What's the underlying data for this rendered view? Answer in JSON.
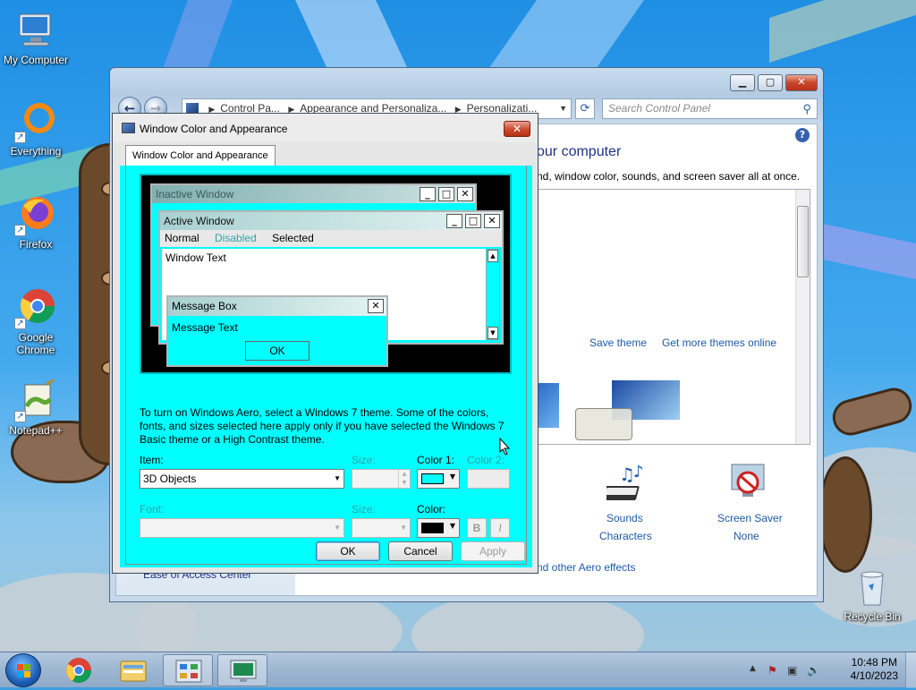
{
  "desktop": {
    "icons": [
      {
        "label": "My Computer",
        "icon": "computer-icon"
      },
      {
        "label": "Everything",
        "icon": "everything-icon"
      },
      {
        "label": "Firefox",
        "icon": "firefox-icon"
      },
      {
        "label": "Google Chrome",
        "icon": "chrome-icon"
      },
      {
        "label": "Notepad++",
        "icon": "notepadpp-icon"
      },
      {
        "label": "Recycle Bin",
        "icon": "recycle-bin-icon"
      }
    ]
  },
  "control_panel": {
    "breadcrumbs": [
      "Control Pa...",
      "Appearance and Personaliza...",
      "Personalizati..."
    ],
    "search_placeholder": "Search Control Panel",
    "heading": "our computer",
    "subtext": "nd, window color, sounds, and screen saver all at once.",
    "save_theme": "Save theme",
    "get_more_themes": "Get more themes online",
    "sounds_label": "Sounds",
    "sounds_value": "Characters",
    "screensaver_label": "Screen Saver",
    "screensaver_value": "None",
    "aero_link": "nd other Aero effects",
    "ease_of_access": "Ease of Access Center"
  },
  "dialog": {
    "title": "Window Color and Appearance",
    "tab": "Window Color and Appearance",
    "preview": {
      "inactive_title": "Inactive Window",
      "active_title": "Active Window",
      "menu_normal": "Normal",
      "menu_disabled": "Disabled",
      "menu_selected": "Selected",
      "window_text": "Window Text",
      "msg_title": "Message Box",
      "msg_text": "Message Text",
      "msg_ok": "OK"
    },
    "info": "To turn on Windows Aero, select a Windows 7 theme.  Some of the colors, fonts, and sizes selected here apply only if you have selected the Windows 7 Basic theme or a High Contrast theme.",
    "item_label": "Item:",
    "item_value": "3D Objects",
    "size_label": "Size:",
    "color1_label": "Color 1:",
    "color2_label": "Color 2:",
    "font_label": "Font:",
    "font_size_label": "Size:",
    "font_color_label": "Color:",
    "bold": "B",
    "italic": "I",
    "ok": "OK",
    "cancel": "Cancel",
    "apply": "Apply",
    "color1_hex": "#00ffff",
    "font_color_hex": "#000000"
  },
  "taskbar": {
    "time": "10:48 PM",
    "date": "4/10/2023"
  }
}
